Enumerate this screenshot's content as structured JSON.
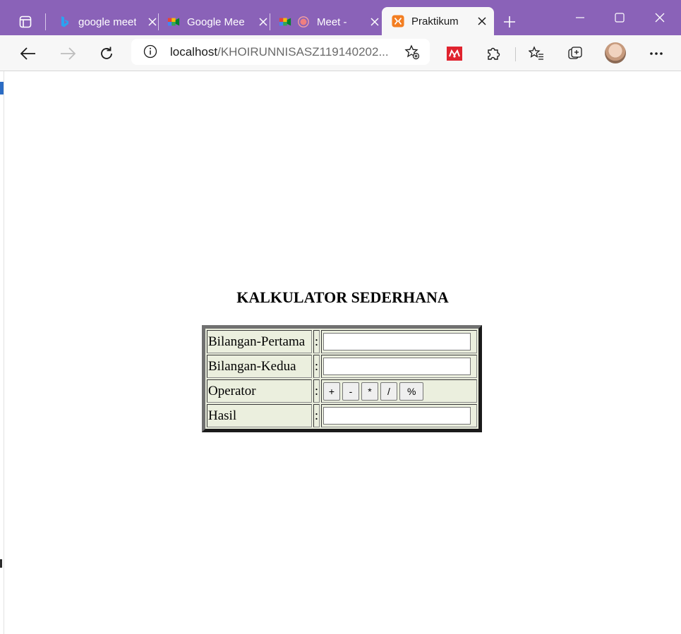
{
  "browser": {
    "tabs": [
      {
        "title": "google meet",
        "icon": "bing-icon",
        "active": false
      },
      {
        "title": "Google Meet",
        "icon": "google-meet-icon",
        "active": false
      },
      {
        "title": "Meet - ",
        "icon": "google-meet-icon",
        "recording": true,
        "active": false
      },
      {
        "title": "Praktikum Mod",
        "icon": "xampp-icon",
        "active": true
      }
    ],
    "address": {
      "host": "localhost",
      "path": "/KHOIRUNNISASZ119140202..."
    },
    "colors": {
      "titlebar": "#8a62b8",
      "toolbar": "#f7f7f7"
    }
  },
  "page": {
    "title": "KALKULATOR SEDERHANA",
    "rows": {
      "first": {
        "label": "Bilangan-Pertama",
        "sep": ":",
        "value": ""
      },
      "second": {
        "label": "Bilangan-Kedua",
        "sep": ":",
        "value": ""
      },
      "operator": {
        "label": "Operator",
        "sep": ":",
        "buttons": [
          "+",
          "-",
          "*",
          "/",
          "%"
        ]
      },
      "result": {
        "label": "Hasil",
        "sep": ":",
        "value": ""
      }
    },
    "colors": {
      "table_bg": "#ebefde",
      "table_border": "#707070"
    }
  }
}
